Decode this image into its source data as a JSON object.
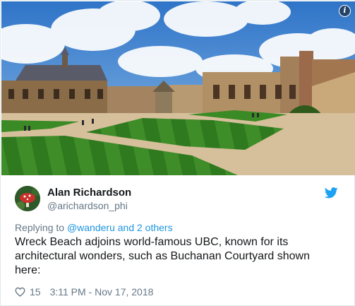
{
  "media": {
    "info_glyph": "i",
    "colors": {
      "sky": "#4a8fd8",
      "lawn": "#3d8a26",
      "stone": "#a78a62",
      "path": "#d8c3a2"
    }
  },
  "tweet": {
    "author_name": "Alan Richardson",
    "author_handle": "@arichardson_phi",
    "reply_prefix": "Replying to",
    "reply_mention": "@wanderu",
    "reply_suffix": "and 2 others",
    "text": "Wreck Beach adjoins world-famous UBC, known for its architectural wonders, such as Buchanan Courtyard shown here:",
    "like_count": "15",
    "timestamp": "3:11 PM - Nov 17, 2018",
    "brand_color": "#1da1f2",
    "mention_color": "#1b95e0"
  },
  "icons": {
    "info": "info-icon",
    "twitter": "twitter-bird-icon",
    "like": "heart-icon"
  }
}
